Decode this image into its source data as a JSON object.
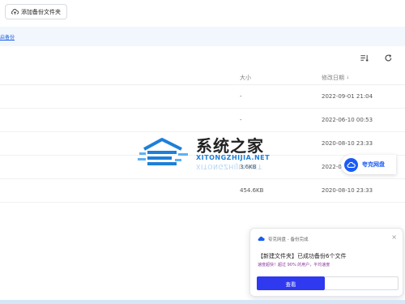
{
  "toolbar": {
    "add_folder_label": "添加备份文件夹",
    "add_icon": "cloud-upload-icon"
  },
  "info_bar": {
    "link_text": "启备份"
  },
  "list_tools": {
    "sort_icon": "sort-list-icon",
    "refresh_icon": "refresh-icon"
  },
  "table": {
    "columns": {
      "size": "大小",
      "modified": "修改日期"
    },
    "sort_glyph": "↓",
    "rows": [
      {
        "size": "-",
        "date": "2022-09-01 21:04"
      },
      {
        "size": "-",
        "date": "2022-06-10 00:53"
      },
      {
        "size": "",
        "date": "2020-08-10 23:33"
      },
      {
        "size": "3.6KB",
        "date": "2022-06-"
      },
      {
        "size": "454.6KB",
        "date": "2020-08-10 23:33"
      }
    ]
  },
  "watermark": {
    "title": "系统之家",
    "subtitle": "XITONGZHIJIA.NET"
  },
  "quark_badge": {
    "label": "夸克网盘",
    "icon": "cloud-icon",
    "color": "#1a5bf5"
  },
  "notification": {
    "app_line": "夸克网盘 - 备份完成",
    "close_glyph": "×",
    "title": "【新建文件夹】已成功备份6个文件",
    "subtitle": "速度超快！超过 90% 的用户，平均速度",
    "primary_button": "查看",
    "primary_color": "#2f39f0"
  }
}
